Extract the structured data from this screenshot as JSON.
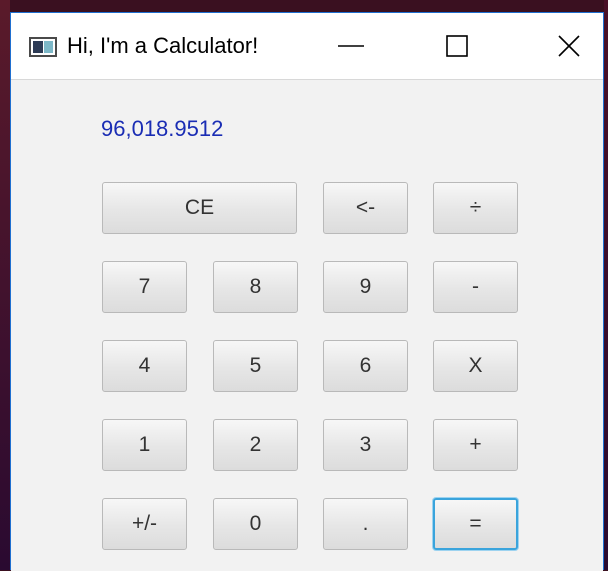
{
  "window": {
    "title": "Hi, I'm a Calculator!",
    "icon": "java-app-icon",
    "controls": {
      "minimize_icon": "minimize-icon",
      "maximize_icon": "maximize-icon",
      "close_icon": "close-icon"
    },
    "accent_color": "#1f6fd0"
  },
  "display": {
    "value": "96,018.9512",
    "color": "#1a2db4"
  },
  "keypad": {
    "ce": "CE",
    "backspace": "<-",
    "divide": "÷",
    "seven": "7",
    "eight": "8",
    "nine": "9",
    "minus": "-",
    "four": "4",
    "five": "5",
    "six": "6",
    "multiply": "X",
    "one": "1",
    "two": "2",
    "three": "3",
    "plus": "+",
    "negate": "+/-",
    "zero": "0",
    "decimal": ".",
    "equals": "="
  },
  "focused_button": "equals",
  "focus_color": "#3aa4dc"
}
